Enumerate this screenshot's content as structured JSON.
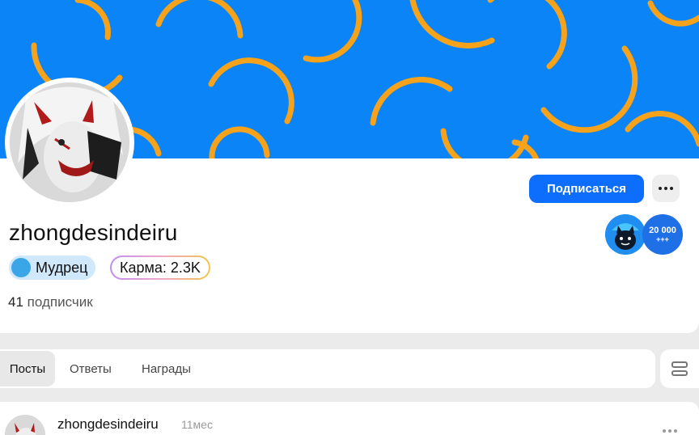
{
  "profile": {
    "username": "zhongdesindeiru",
    "rank_label": "Мудрец",
    "karma_label": "Карма:",
    "karma_value": "2.3K",
    "followers_count": "41",
    "followers_label": "подписчик",
    "subscribe_label": "Подписаться",
    "awards": [
      {
        "icon": "cat-award-icon"
      },
      {
        "line1": "20 000",
        "line2": "+++"
      }
    ]
  },
  "tabs": [
    {
      "label": "Посты",
      "active": true
    },
    {
      "label": "Ответы",
      "active": false
    },
    {
      "label": "Награды",
      "active": false
    }
  ],
  "post": {
    "author": "zhongdesindeiru",
    "time": "11мес"
  },
  "colors": {
    "banner": "#0a84f7",
    "banner_arcs": "#f7a21b",
    "primary_button": "#0d6efd"
  }
}
